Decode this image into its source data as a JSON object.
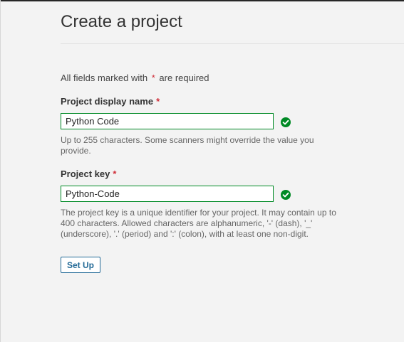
{
  "page": {
    "title": "Create a project"
  },
  "form": {
    "required_note_prefix": "All fields marked with",
    "required_marker": "*",
    "required_note_suffix": "are required",
    "display_name": {
      "label": "Project display name",
      "value": "Python Code",
      "help": "Up to 255 characters. Some scanners might override the value you provide."
    },
    "project_key": {
      "label": "Project key",
      "value": "Python-Code",
      "help": "The project key is a unique identifier for your project. It may contain up to 400 characters. Allowed characters are alphanumeric, '-' (dash), '_' (underscore), '.' (period) and ':' (colon), with at least one non-digit."
    },
    "submit_label": "Set Up"
  },
  "icons": {
    "valid": "check-circle-icon"
  },
  "colors": {
    "valid_green": "#008a25",
    "required_red": "#d02f3a",
    "button_blue": "#236a97"
  }
}
